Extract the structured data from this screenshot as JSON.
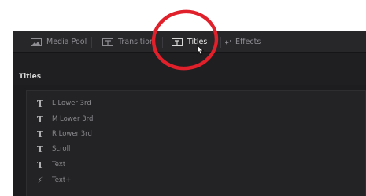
{
  "toolbar": {
    "tabs": [
      {
        "label": "Media Pool",
        "icon": "media-pool-icon"
      },
      {
        "label": "Transition",
        "icon": "transition-icon"
      },
      {
        "label": "Titles",
        "icon": "titles-icon",
        "active": true
      },
      {
        "label": "Effects",
        "icon": "effects-icon"
      }
    ]
  },
  "section": {
    "title": "Titles"
  },
  "titles_list": [
    {
      "label": "L Lower 3rd",
      "icon": "T"
    },
    {
      "label": "M Lower 3rd",
      "icon": "T"
    },
    {
      "label": "R Lower 3rd",
      "icon": "T"
    },
    {
      "label": "Scroll",
      "icon": "T"
    },
    {
      "label": "Text",
      "icon": "T"
    },
    {
      "label": "Text+",
      "icon": "⚡"
    }
  ],
  "colors": {
    "annotation": "#e0202a",
    "panel_bg": "#1d1d1f",
    "toolbar_bg": "#27272a",
    "active_text": "#e6e6e6"
  }
}
